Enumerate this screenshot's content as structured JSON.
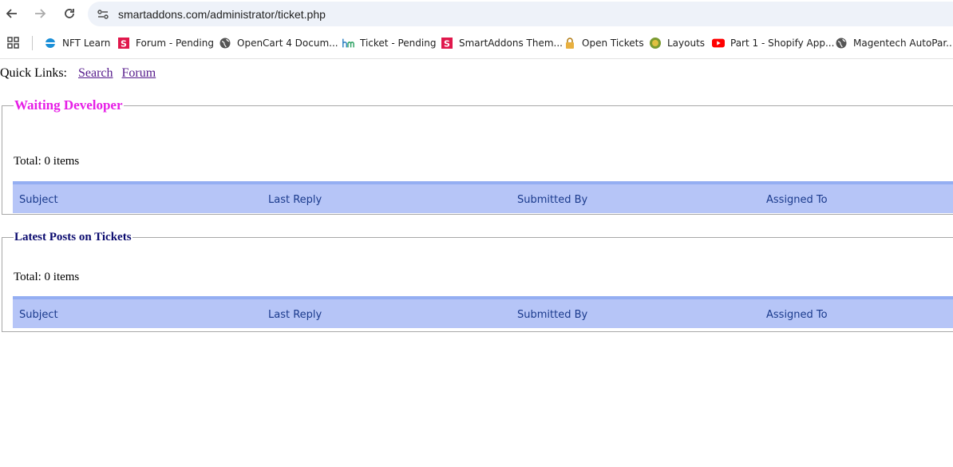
{
  "browser": {
    "url": "smartaddons.com/administrator/ticket.php",
    "bookmarks": [
      {
        "label": "NFT Learn",
        "icon": "nft-learn-icon",
        "color": "#1a8fd8"
      },
      {
        "label": "Forum - Pending",
        "icon": "smartaddons-s-icon",
        "color": "#e0184c"
      },
      {
        "label": "OpenCart 4 Docum...",
        "icon": "globe-icon",
        "color": "#555555"
      },
      {
        "label": "Ticket - Pending",
        "icon": "hm-logo-icon",
        "color": "#2a7fc1"
      },
      {
        "label": "SmartAddons Them...",
        "icon": "smartaddons-s-icon",
        "color": "#e0184c"
      },
      {
        "label": "Open Tickets",
        "icon": "lock-icon",
        "color": "#e0a030"
      },
      {
        "label": "Layouts",
        "icon": "layouts-icon",
        "color": "#7a9a30"
      },
      {
        "label": "Part 1 - Shopify App...",
        "icon": "youtube-icon",
        "color": "#ff0000"
      },
      {
        "label": "Magentech AutoPar...",
        "icon": "globe-icon",
        "color": "#555555"
      }
    ]
  },
  "quick_links": {
    "label": "Quick Links:",
    "links": [
      "Search",
      "Forum"
    ]
  },
  "sections": [
    {
      "title": "Waiting Developer",
      "title_color": "#e61ee6",
      "total": "Total: 0 items",
      "columns": [
        "Subject",
        "Last Reply",
        "Submitted By",
        "Assigned To"
      ]
    },
    {
      "title": "Latest Posts on Tickets",
      "title_color": "#0a0a6e",
      "total": "Total: 0 items",
      "columns": [
        "Subject",
        "Last Reply",
        "Submitted By",
        "Assigned To"
      ]
    }
  ]
}
